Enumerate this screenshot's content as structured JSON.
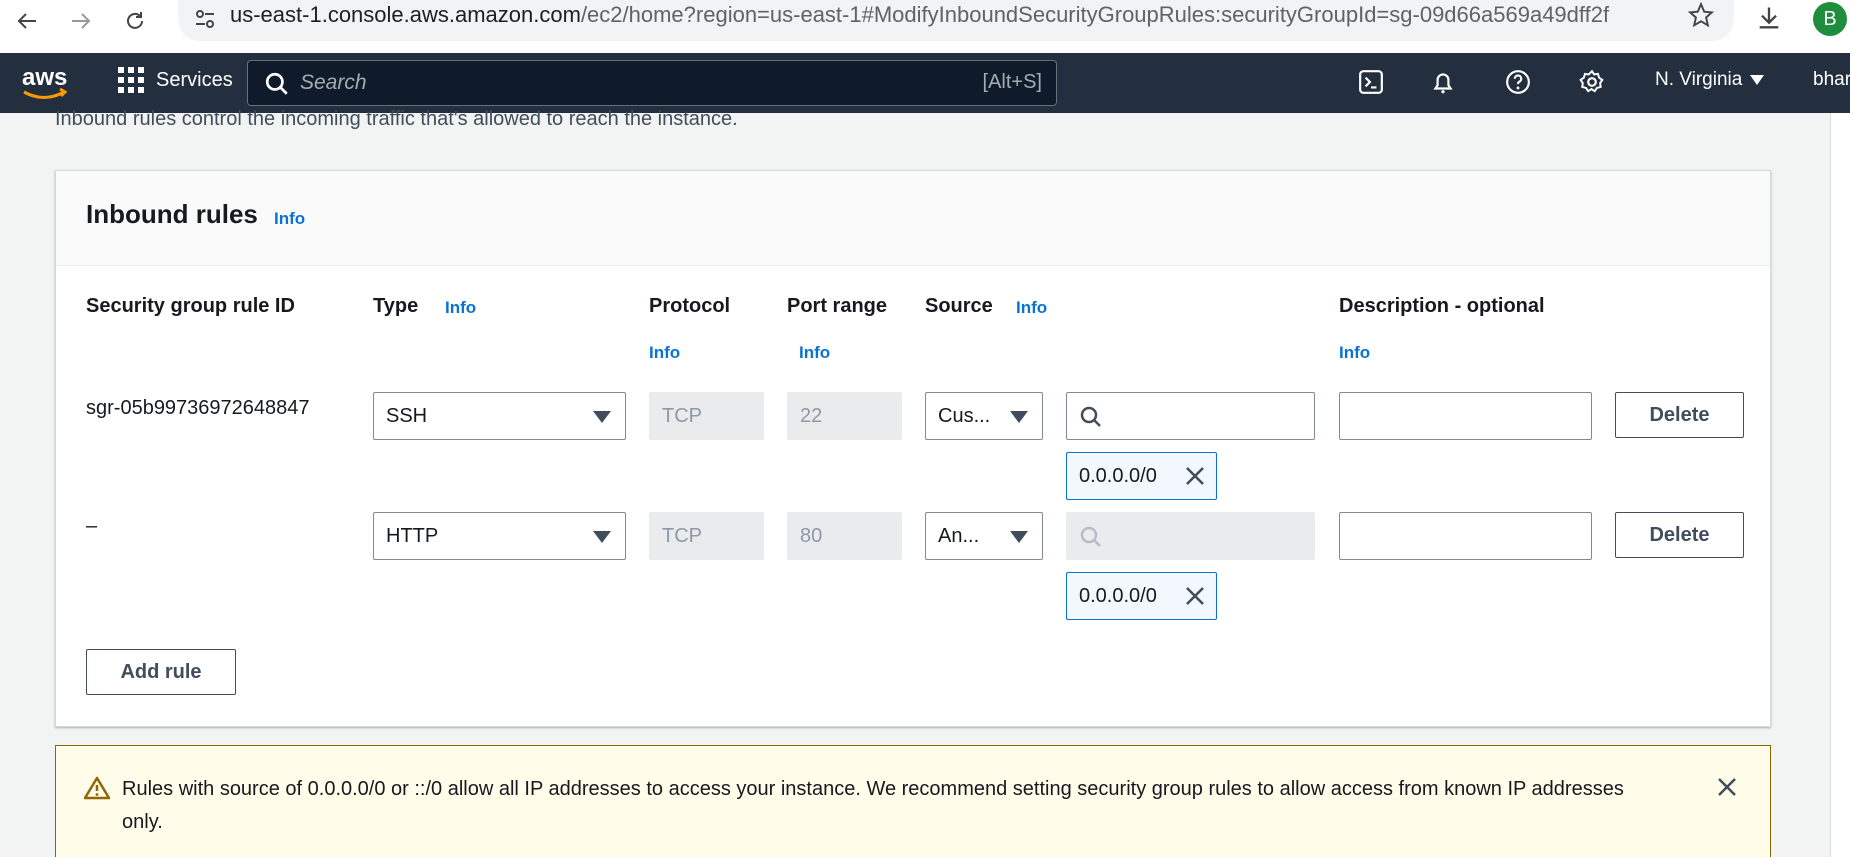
{
  "browser": {
    "url_host": "us-east-1.console.aws.amazon.com",
    "url_path": "/ec2/home?region=us-east-1#ModifyInboundSecurityGroupRules:securityGroupId=sg-09d66a569a49dff2f",
    "profile_initial": "B"
  },
  "header": {
    "services_label": "Services",
    "search_placeholder": "Search",
    "search_shortcut": "[Alt+S]",
    "region": "N. Virginia",
    "user": "bhar"
  },
  "page": {
    "description": "Inbound rules control the incoming traffic that's allowed to reach the instance."
  },
  "inbound": {
    "title": "Inbound rules",
    "info": "Info",
    "columns": {
      "rule_id": "Security group rule ID",
      "type": "Type",
      "protocol": "Protocol",
      "port_range": "Port range",
      "source": "Source",
      "description": "Description - optional"
    },
    "rows": [
      {
        "rule_id": "sgr-05b99736972648847",
        "type": "SSH",
        "protocol": "TCP",
        "port": "22",
        "source": "Cus...",
        "cidr": "0.0.0.0/0"
      },
      {
        "rule_id": "–",
        "type": "HTTP",
        "protocol": "TCP",
        "port": "80",
        "source": "An...",
        "cidr": "0.0.0.0/0"
      }
    ],
    "delete_label": "Delete",
    "add_rule_label": "Add rule"
  },
  "alert": {
    "text": "Rules with source of 0.0.0.0/0 or ::/0 allow all IP addresses to access your instance. We recommend setting security group rules to allow access from known IP addresses only."
  },
  "colors": {
    "aws_header": "#232f3e",
    "link_blue": "#0972d3",
    "alert_bg": "#fffce9"
  }
}
